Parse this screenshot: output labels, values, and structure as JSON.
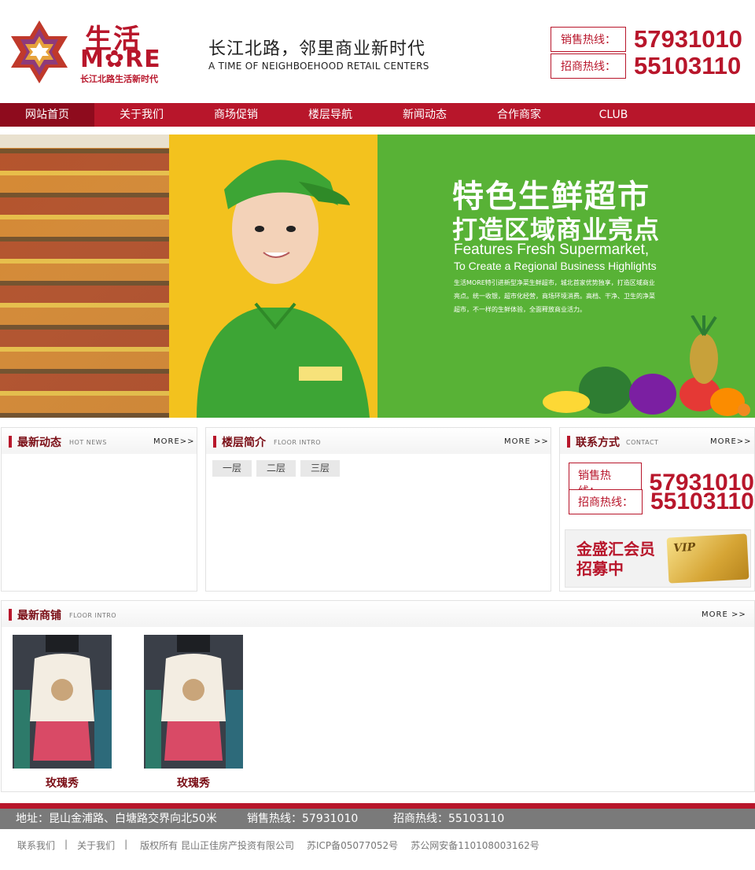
{
  "header": {
    "logo_line1": "生活",
    "logo_line2": "M✿RE",
    "logo_line3": "长江北路生活新时代",
    "slogan_cn": "长江北路，邻里商业新时代",
    "slogan_en": "A TIME OF NEIGHBOEHOOD RETAIL CENTERS",
    "sales_label": "销售热线：",
    "sales_number": "57931010",
    "invest_label": "招商热线：",
    "invest_number": "55103110"
  },
  "nav": {
    "items": [
      "网站首页",
      "关于我们",
      "商场促销",
      "楼层导航",
      "新闻动态",
      "合作商家",
      "CLUB"
    ]
  },
  "banner": {
    "title1": "特色生鲜超市",
    "title2": "打造区域商业亮点",
    "en1": "Features Fresh Supermarket,",
    "en2": "To Create a Regional Business Highlights",
    "desc": "生活MORE特引进新型净菜生鲜超市，城北首家优势独享，打造区域商业亮点。统一收银，超市化经营，商场环境消费。高档、干净、卫生的净菜超市，不一样的生鲜体验，全面释放商业活力。"
  },
  "news_panel": {
    "title": "最新动态",
    "subtitle": "HOT NEWS",
    "more": "MORE>>"
  },
  "floor_panel": {
    "title": "楼层简介",
    "subtitle": "FLOOR INTRO",
    "more": "MORE >>",
    "tabs": [
      "一层",
      "二层",
      "三层"
    ]
  },
  "contact_panel": {
    "title": "联系方式",
    "subtitle": "CONTACT",
    "more": "MORE>>",
    "sales_label": "销售热线：",
    "sales_number": "57931010",
    "invest_label": "招商热线：",
    "invest_number": "55103110",
    "vip_line1": "金盛汇会员",
    "vip_line2": "招募中",
    "vip_card_text": "VIP"
  },
  "shops_panel": {
    "title": "最新商铺",
    "subtitle": "FLOOR INTRO",
    "more": "MORE >>",
    "shops": [
      {
        "name": "玫瑰秀"
      },
      {
        "name": "玫瑰秀"
      }
    ]
  },
  "footer": {
    "address": "地址：昆山金浦路、白塘路交界向北50米",
    "sales": "销售热线：57931010",
    "invest": "招商热线：55103110",
    "link_contact": "联系我们",
    "link_about": "关于我们",
    "separator": "|",
    "copyright": "版权所有 昆山正佳房产投资有限公司",
    "icp": "苏ICP备05077052号",
    "police": "苏公网安备110108003162号"
  },
  "colors": {
    "brand_red": "#b8162b",
    "nav_active": "#8e0b1d",
    "banner_green": "#58b236"
  }
}
